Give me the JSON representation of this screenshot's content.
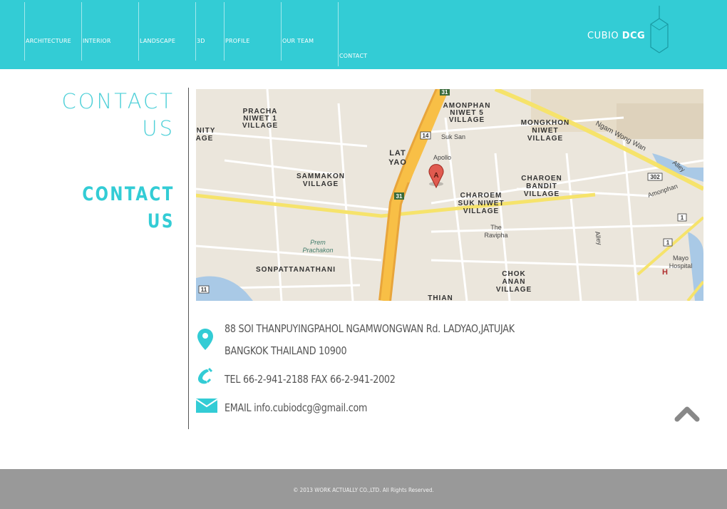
{
  "nav": {
    "items": [
      {
        "label": "ARCHITECTURE"
      },
      {
        "label": "INTERIOR"
      },
      {
        "label": "LANDSCAPE"
      },
      {
        "label": "3D"
      },
      {
        "label": "PROFILE"
      },
      {
        "label": "OUR TEAM"
      },
      {
        "label": "CONTACT"
      }
    ]
  },
  "brand": {
    "name_light": "CUBIO ",
    "name_bold": "DCG"
  },
  "page": {
    "title_top_1": "CONTACT",
    "title_top_2": "US",
    "title_bottom_1": "CONTACT",
    "title_bottom_2": "US"
  },
  "map": {
    "labels": {
      "pracha": "PRACHA",
      "niwet1": "NIWET 1",
      "village1": "VILLAGE",
      "amonphan": "AMONPHAN",
      "niwet5": "NIWET 5",
      "village2": "VILLAGE",
      "lat": "LAT",
      "yao": "YAO",
      "suksan": "Suk San",
      "apollo": "Apollo",
      "mongkhon": "MONGKHON",
      "niwetm": "NIWET",
      "village3": "VILLAGE",
      "ngamwongwan": "Ngam Wong Wan",
      "sammakon": "SAMMAKON",
      "village4": "VILLAGE",
      "charoen": "CHAROEN",
      "bandit": "BANDIT",
      "village5": "VILLAGE",
      "charoem": "CHAROEM",
      "suk": "SUK NIWET",
      "village6": "VILLAGE",
      "amonphan2": "Amonphan",
      "alley": "Alley",
      "alley2": "Alley",
      "the": "The",
      "ravipha": "Ravipha",
      "prem": "Prem",
      "prachakon": "Prachakon",
      "sonpatta": "SONPATTANATHANI",
      "chok": "CHOK",
      "anan": "ANAN",
      "village7": "VILLAGE",
      "thian": "THIAN",
      "mayo": "Mayo",
      "hospital": "Hospital",
      "nity": "NITY",
      "age": "AGE",
      "shield31": "31",
      "shield14": "14",
      "shield31b": "31",
      "shield302": "302",
      "shield1a": "1",
      "shield1b": "1",
      "shield11": "11",
      "marker": "A"
    }
  },
  "contact": {
    "address_line1": "88 SOI THANPUYINGPAHOL NGAMWONGWAN Rd. LADYAO,JATUJAK",
    "address_line2": "BANGKOK THAILAND 10900",
    "phone": "TEL 66-2-941-2188 FAX 66-2-941-2002",
    "email": "EMAIL info.cubiodcg@gmail.com"
  },
  "footer": {
    "copyright": "© 2013 WORK ACTUALLY CO.,LTD.  All Rights Reserved."
  },
  "colors": {
    "accent": "#33ccd5",
    "footer": "#999999",
    "text": "#555555"
  }
}
